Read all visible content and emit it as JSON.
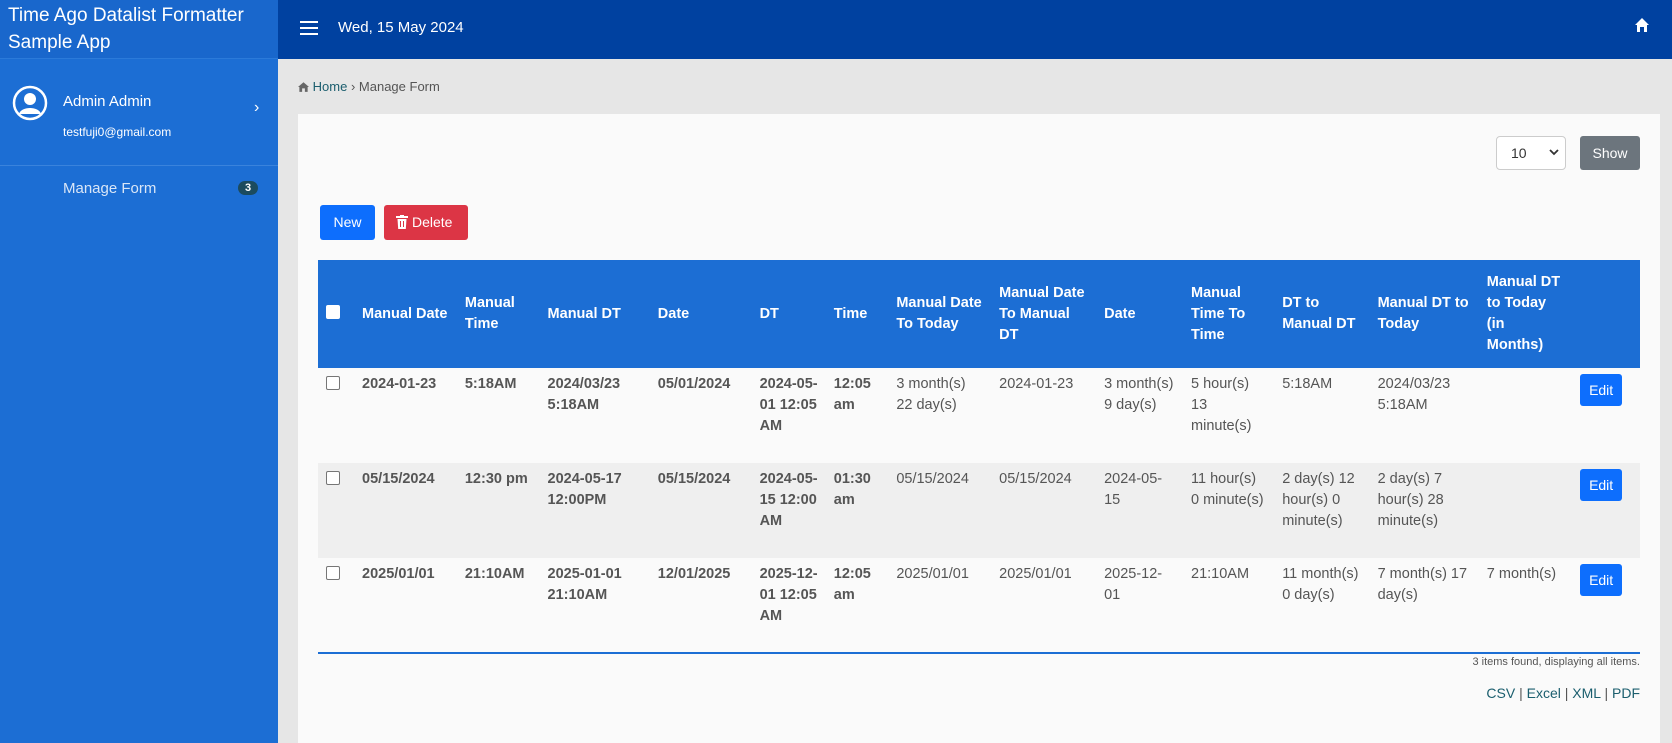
{
  "sidebar": {
    "brand": "Time Ago Datalist Formatter Sample App",
    "user": {
      "name": "Admin Admin",
      "email": "testfuji0@gmail.com"
    },
    "nav": [
      {
        "label": "Manage Form",
        "badge": "3"
      }
    ]
  },
  "topbar": {
    "date": "Wed, 15 May 2024"
  },
  "breadcrumb": {
    "home": "Home",
    "separator": "›",
    "current": "Manage Form"
  },
  "controls": {
    "page_size": "10",
    "show_label": "Show",
    "new_label": "New",
    "delete_label": "Delete"
  },
  "table": {
    "columns": [
      "Manual Date",
      "Manual Time",
      "Manual DT",
      "Date",
      "DT",
      "Time",
      "Manual Date To Today",
      "Manual Date To Manual DT",
      "Date",
      "Manual Time To Time",
      "DT to Manual DT",
      "Manual DT to Today",
      "Manual DT to Today (in Months)"
    ],
    "edit_label": "Edit",
    "rows": [
      [
        "2024-01-23",
        "5:18AM",
        "2024/03/23 5:18AM",
        "05/01/2024",
        "2024-05-01 12:05 AM",
        "12:05 am",
        "3 month(s) 22 day(s)",
        "2024-01-23",
        "3 month(s) 9 day(s)",
        "5 hour(s) 13 minute(s)",
        "5:18AM",
        "2024/03/23 5:18AM",
        ""
      ],
      [
        "05/15/2024",
        "12:30 pm",
        "2024-05-17 12:00PM",
        "05/15/2024",
        "2024-05-15 12:00 AM",
        "01:30 am",
        "05/15/2024",
        "05/15/2024",
        "2024-05-15",
        "11 hour(s) 0 minute(s)",
        "2 day(s) 12 hour(s) 0 minute(s)",
        "2 day(s) 7 hour(s) 28 minute(s)",
        ""
      ],
      [
        "2025/01/01",
        "21:10AM",
        "2025-01-01 21:10AM",
        "12/01/2025",
        "2025-12-01 12:05 AM",
        "12:05 am",
        "2025/01/01",
        "2025/01/01",
        "2025-12-01",
        "21:10AM",
        "11 month(s) 0 day(s)",
        "7 month(s) 17 day(s)",
        "7 month(s)"
      ]
    ]
  },
  "footer": {
    "found": "3 items found, displaying all items.",
    "exports": [
      "CSV",
      "Excel",
      "XML",
      "PDF"
    ],
    "separator": "|"
  }
}
